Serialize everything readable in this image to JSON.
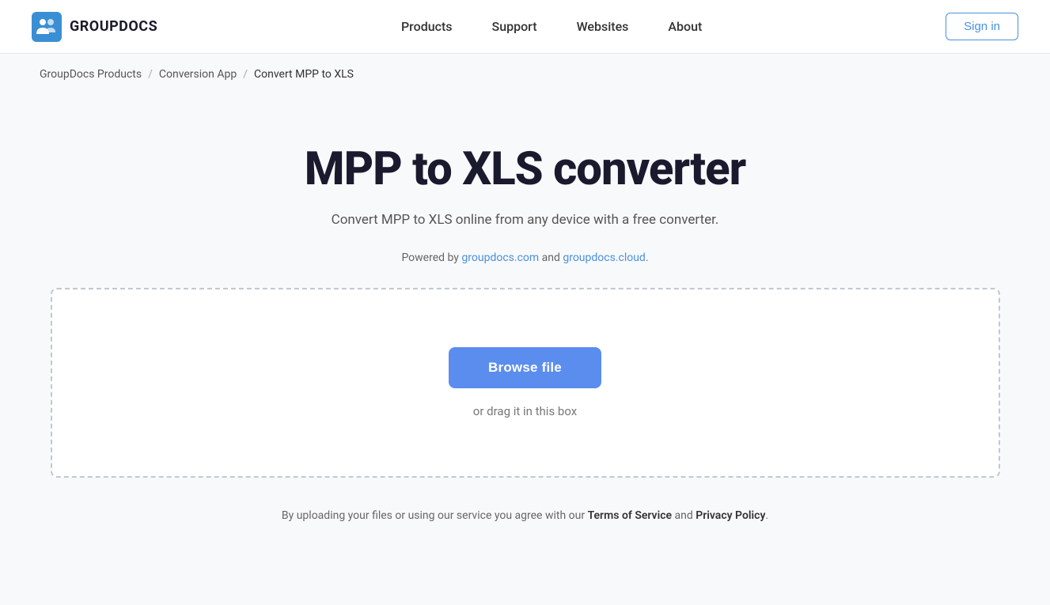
{
  "header": {
    "logo_text": "GROUPDOCS",
    "nav_items": [
      {
        "label": "Products"
      },
      {
        "label": "Support"
      },
      {
        "label": "Websites"
      },
      {
        "label": "About"
      }
    ],
    "sign_in_label": "Sign in"
  },
  "breadcrumb": {
    "items": [
      {
        "label": "GroupDocs Products",
        "href": "#"
      },
      {
        "label": "Conversion App",
        "href": "#"
      },
      {
        "label": "Convert MPP to XLS"
      }
    ]
  },
  "main": {
    "title": "MPP to XLS converter",
    "subtitle": "Convert MPP to XLS online from any device with a free converter.",
    "powered_by_prefix": "Powered by ",
    "powered_by_link1": "groupdocs.com",
    "powered_by_and": " and ",
    "powered_by_link2": "groupdocs.cloud",
    "powered_by_suffix": ".",
    "browse_file_label": "Browse file",
    "drag_text": "or drag it in this box",
    "footer_note_prefix": "By uploading your files or using our service you agree with our ",
    "footer_terms": "Terms of Service",
    "footer_and": " and ",
    "footer_privacy": "Privacy Policy",
    "footer_suffix": "."
  },
  "colors": {
    "accent": "#5b8dee",
    "logo_blue": "#3a8fd4"
  }
}
